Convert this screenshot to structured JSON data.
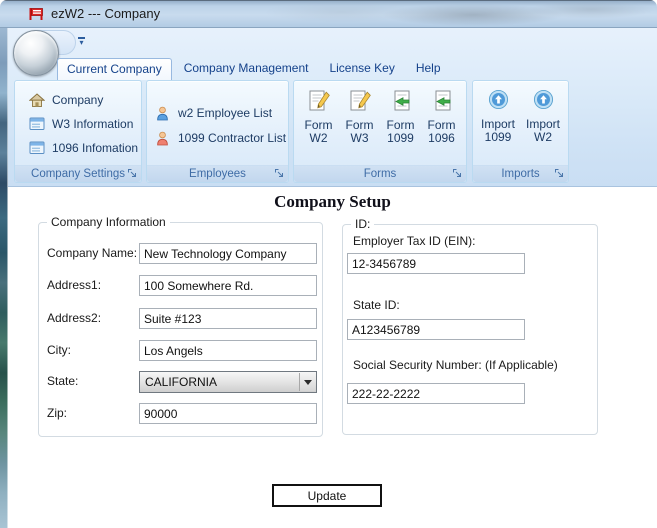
{
  "window": {
    "title": "ezW2 --- Company"
  },
  "tabs": [
    {
      "label": "Current Company"
    },
    {
      "label": "Company Management"
    },
    {
      "label": "License Key"
    },
    {
      "label": "Help"
    }
  ],
  "ribbon": {
    "groups": [
      {
        "name": "Company Settings",
        "items": [
          {
            "label": "Company"
          },
          {
            "label": "W3 Information"
          },
          {
            "label": "1096 Infomation"
          }
        ]
      },
      {
        "name": "Employees",
        "items": [
          {
            "label": "w2 Employee List"
          },
          {
            "label": "1099 Contractor List"
          }
        ]
      },
      {
        "name": "Forms",
        "items": [
          {
            "line1": "Form",
            "line2": "W2"
          },
          {
            "line1": "Form",
            "line2": "W3"
          },
          {
            "line1": "Form",
            "line2": "1099"
          },
          {
            "line1": "Form",
            "line2": "1096"
          }
        ]
      },
      {
        "name": "Imports",
        "items": [
          {
            "line1": "Import",
            "line2": "1099"
          },
          {
            "line1": "Import",
            "line2": "W2"
          }
        ]
      }
    ]
  },
  "main": {
    "title": "Company Setup",
    "company_info": {
      "legend": "Company Information",
      "fields": [
        {
          "label": "Company Name:",
          "value": "New Technology Company"
        },
        {
          "label": "Address1:",
          "value": "100 Somewhere Rd."
        },
        {
          "label": "Address2:",
          "value": "Suite #123"
        },
        {
          "label": "City:",
          "value": "Los Angels"
        },
        {
          "label": "State:",
          "value": "CALIFORNIA"
        },
        {
          "label": "Zip:",
          "value": "90000"
        }
      ]
    },
    "id_info": {
      "legend": "ID:",
      "fields": [
        {
          "label": "Employer Tax ID (EIN):",
          "value": "12-3456789"
        },
        {
          "label": "State ID:",
          "value": "A123456789"
        },
        {
          "label": "Social Security Number: (If Applicable)",
          "value": "222-22-2222"
        }
      ]
    },
    "update_button": "Update"
  },
  "colors": {
    "accent_text": "#15428b",
    "group_label": "#3f6ca6",
    "titlebar": "#bcd2e8",
    "ribbon_bg": "#dcebf9",
    "app_icon_red": "#cc1111"
  }
}
